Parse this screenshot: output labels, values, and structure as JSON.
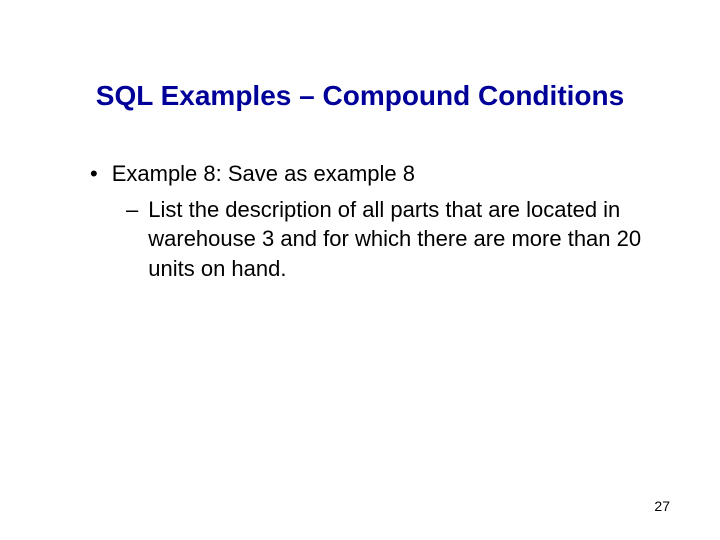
{
  "title": "SQL Examples – Compound Conditions",
  "bullet1": "Example 8: Save as example 8",
  "bullet2": "List the description of all parts that are located in warehouse 3 and for which there are more than 20 units on hand.",
  "pagenum": "27"
}
